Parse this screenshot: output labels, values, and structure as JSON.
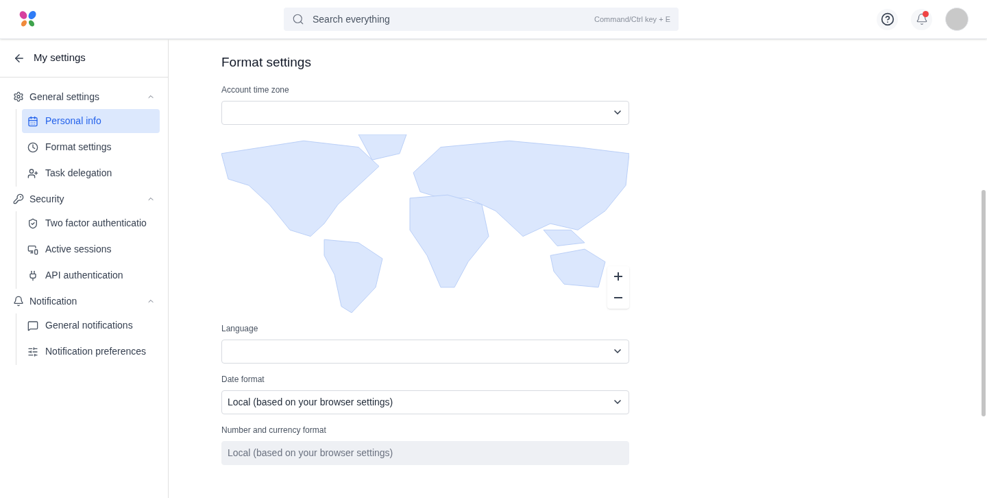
{
  "header": {
    "search": {
      "placeholder": "Search everything",
      "shortcut": "Command/Ctrl key + E"
    },
    "notifications_unread": true
  },
  "sidebar": {
    "title": "My settings",
    "groups": [
      {
        "label": "General settings",
        "expanded": true,
        "items": [
          {
            "label": "Personal info",
            "selected": true
          },
          {
            "label": "Format settings",
            "selected": false
          },
          {
            "label": "Task delegation",
            "selected": false
          }
        ]
      },
      {
        "label": "Security",
        "expanded": true,
        "items": [
          {
            "label": "Two factor authenticatio",
            "selected": false
          },
          {
            "label": "Active sessions",
            "selected": false
          },
          {
            "label": "API authentication",
            "selected": false
          }
        ]
      },
      {
        "label": "Notification",
        "expanded": true,
        "items": [
          {
            "label": "General notifications",
            "selected": false
          },
          {
            "label": "Notification preferences",
            "selected": false
          }
        ]
      }
    ]
  },
  "main": {
    "title": "Format settings",
    "fields": [
      {
        "kind": "select",
        "label": "Account time zone",
        "disabled": false
      },
      {
        "kind": "map"
      },
      {
        "kind": "select",
        "label": "Language",
        "disabled": false
      },
      {
        "kind": "select",
        "label": "Date format",
        "value": "Local (based on your browser settings)",
        "disabled": false
      },
      {
        "kind": "select",
        "label": "Number and currency format",
        "value": "Local (based on your browser settings)",
        "disabled": true
      }
    ]
  }
}
